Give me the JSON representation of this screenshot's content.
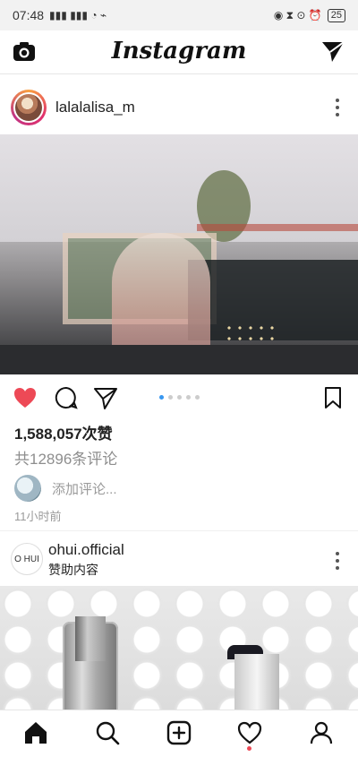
{
  "status_bar": {
    "time": "07:48",
    "signal": "೟೟",
    "battery": "25"
  },
  "header": {
    "app_title": "Instagram"
  },
  "post": {
    "username": "lalalalisa_m",
    "likes_text": "1,588,057次赞",
    "comments_link": "共12896条评论",
    "add_comment_placeholder": "添加评论...",
    "time_ago": "11小时前",
    "carousel": {
      "total": 5,
      "active_index": 1
    }
  },
  "ad": {
    "logo_text": "O HUI",
    "name": "ohui.official",
    "sponsored_label": "赞助内容"
  },
  "bottom_nav": [
    "home",
    "search",
    "new-post",
    "activity",
    "profile"
  ],
  "colors": {
    "like_red": "#ed4956",
    "carousel_active": "#3897f0",
    "text": "#222222",
    "muted": "#8e8e8e"
  }
}
